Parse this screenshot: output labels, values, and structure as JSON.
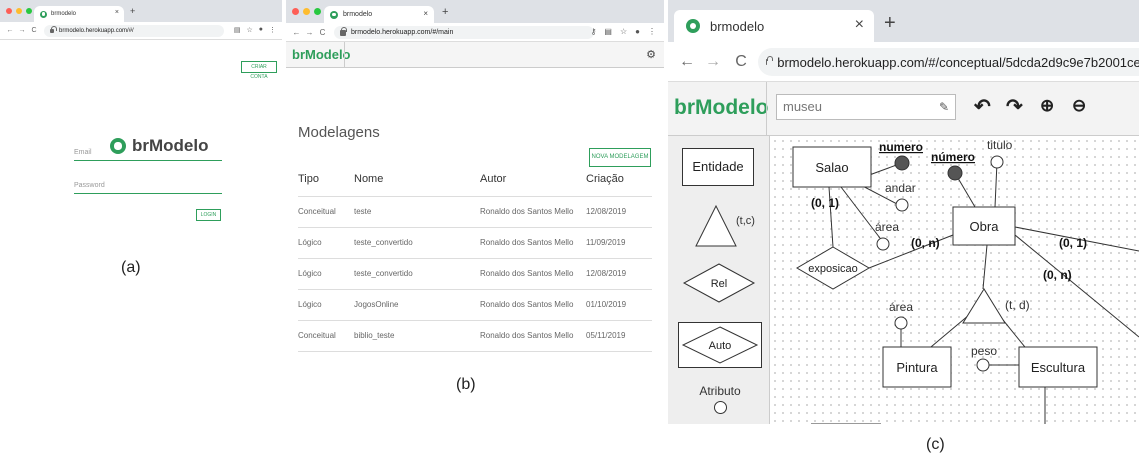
{
  "panel_a": {
    "tab_title": "brmodelo",
    "url": "brmodelo.herokuapp.com/#/",
    "create_account_label": "CRIAR CONTA",
    "logo_text": "brModelo",
    "email_label": "Email",
    "password_label": "Password",
    "login_label": "LOGIN",
    "caption": "(a)"
  },
  "panel_b": {
    "tab_title": "brmodelo",
    "url": "brmodelo.herokuapp.com/#/main",
    "app_title": "brModelo",
    "heading": "Modelagens",
    "new_model_label": "NOVA MODELAGEM",
    "columns": [
      "Tipo",
      "Nome",
      "Autor",
      "Criação"
    ],
    "rows": [
      [
        "Conceitual",
        "teste",
        "Ronaldo dos Santos Mello",
        "12/08/2019"
      ],
      [
        "Lógico",
        "teste_convertido",
        "Ronaldo dos Santos Mello",
        "11/09/2019"
      ],
      [
        "Lógico",
        "teste_convertido",
        "Ronaldo dos Santos Mello",
        "12/08/2019"
      ],
      [
        "Lógico",
        "JogosOnline",
        "Ronaldo dos Santos Mello",
        "01/10/2019"
      ],
      [
        "Conceitual",
        "biblio_teste",
        "Ronaldo dos Santos Mello",
        "05/11/2019"
      ]
    ],
    "caption": "(b)"
  },
  "panel_c": {
    "tab_title": "brmodelo",
    "url": "brmodelo.herokuapp.com/#/conceptual/5dcda2d9c9e7b2001ceb",
    "app_title": "brModelo",
    "model_name": "museu",
    "palette": {
      "entity": "Entidade",
      "spec": "(t,c)",
      "rel": "Rel",
      "auto": "Auto",
      "attribute": "Atributo"
    },
    "diagram": {
      "salao": "Salao",
      "numero1": "numero",
      "andar": "andar",
      "card1": "(0, 1)",
      "area1": "área",
      "exposicao": "exposicao",
      "card2": "(0, n)",
      "numero2": "número",
      "titulo": "titulo",
      "obra": "Obra",
      "card3": "(0, 1)",
      "card4": "(0, n)",
      "spec": "(t, d)",
      "area2": "área",
      "peso": "peso",
      "pintura": "Pintura",
      "escultura": "Escultura"
    },
    "caption": "(c)"
  },
  "colors": {
    "accent": "#2e9e5b",
    "tabstrip": "#dee1e6"
  }
}
